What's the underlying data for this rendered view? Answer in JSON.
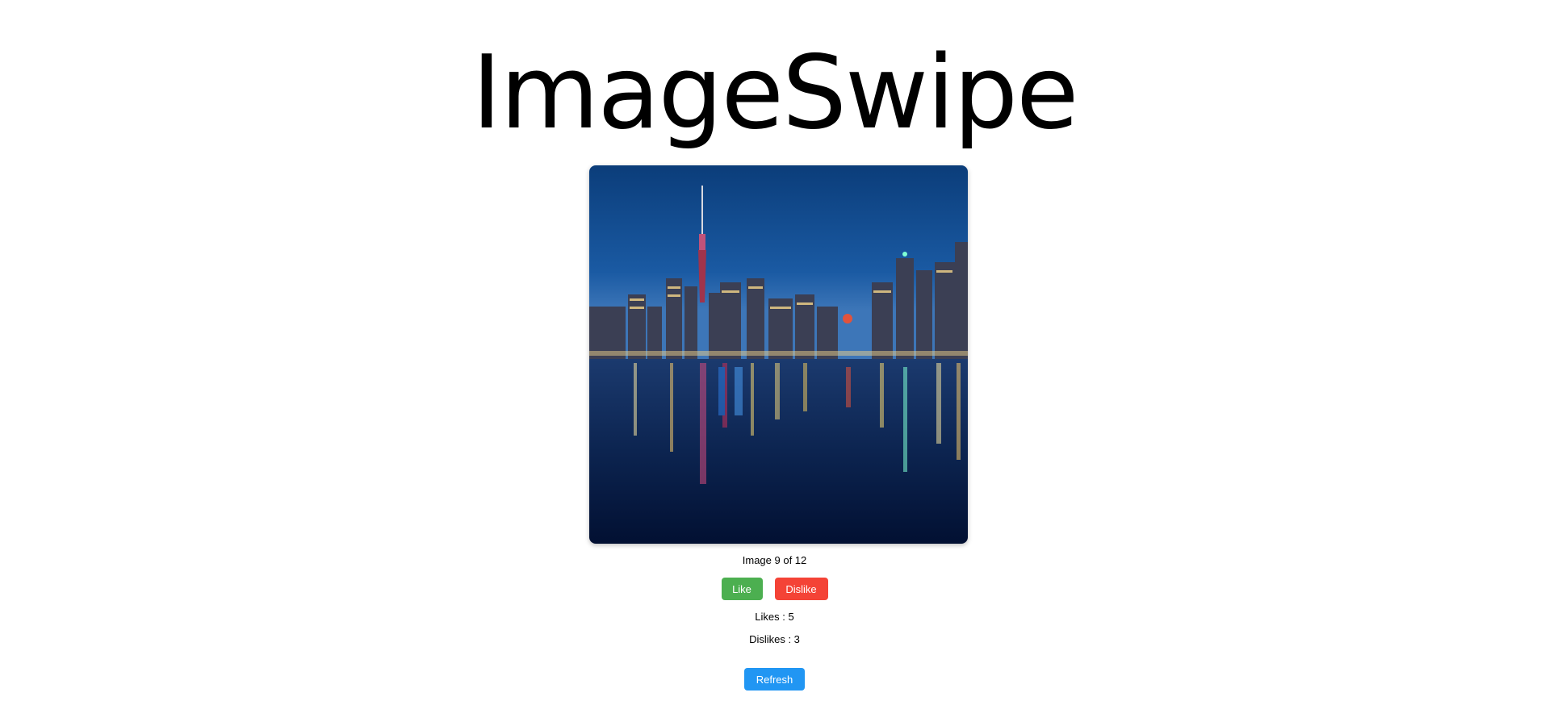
{
  "app": {
    "title": "ImageSwipe"
  },
  "image": {
    "subject": "city-skyline-night-icon"
  },
  "counter": {
    "text": "Image 9 of 12"
  },
  "buttons": {
    "like_label": "Like",
    "dislike_label": "Dislike",
    "refresh_label": "Refresh"
  },
  "stats": {
    "likes_text": "Likes : 5",
    "dislikes_text": "Dislikes : 3"
  },
  "colors": {
    "like": "#4caf50",
    "dislike": "#f44336",
    "refresh": "#2196f3"
  }
}
